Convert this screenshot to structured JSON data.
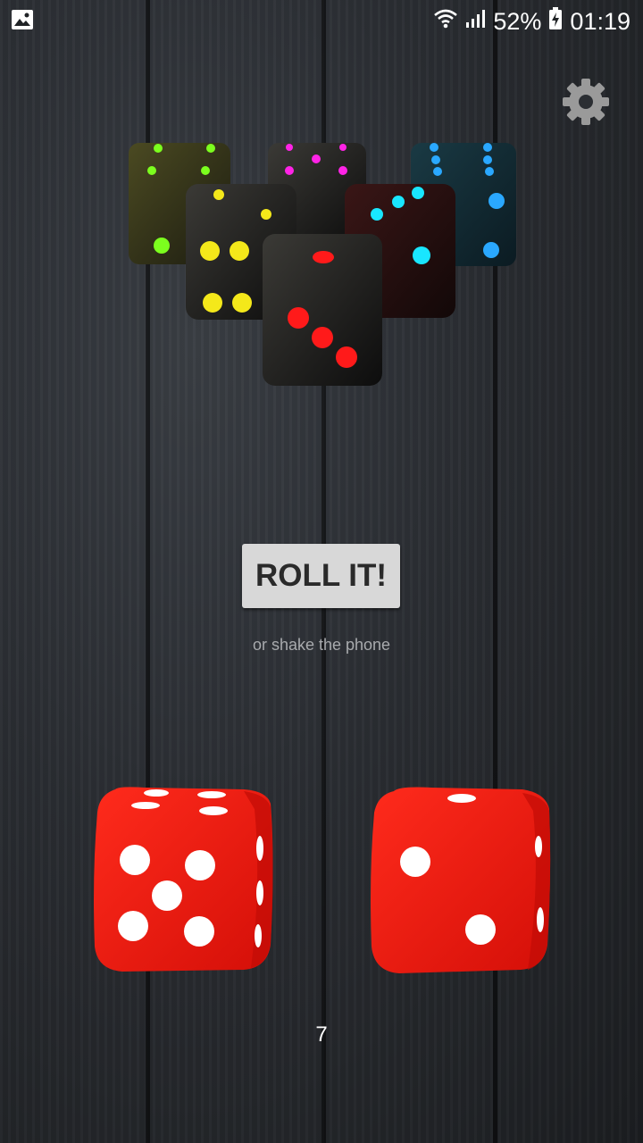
{
  "status_bar": {
    "battery": "52%",
    "time": "01:19",
    "icons": [
      "image-notification-icon",
      "wifi-icon",
      "signal-icon",
      "battery-charging-icon"
    ]
  },
  "settings": {
    "icon": "gear-icon"
  },
  "roll_button": {
    "label": "ROLL IT!"
  },
  "hint": "or shake the phone",
  "dice": [
    {
      "value": 5,
      "color": "#e8170f"
    },
    {
      "value": 2,
      "color": "#e8170f"
    }
  ],
  "total": "7",
  "logo": {
    "icon": "dice-pile-logo",
    "pip_colors": [
      "#7cff1e",
      "#ff23e6",
      "#2aa8ff",
      "#f4e81a",
      "#19e6ff",
      "#ff1a1a"
    ]
  }
}
